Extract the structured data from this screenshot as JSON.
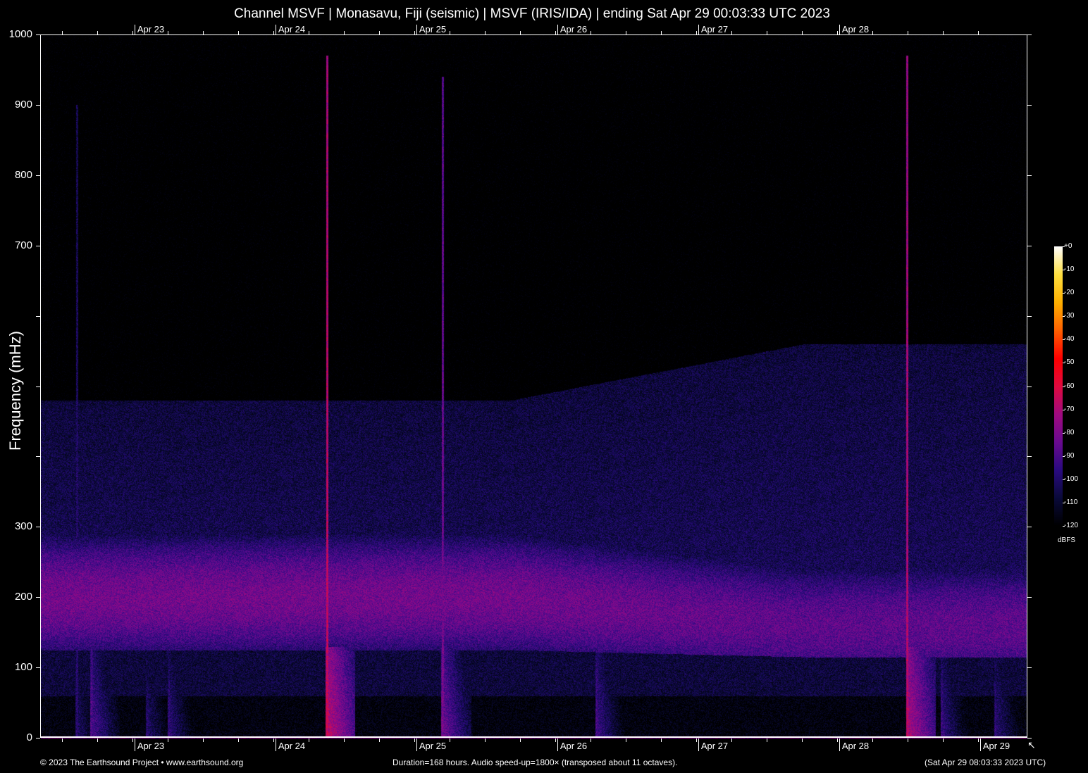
{
  "title": "Channel MSVF | Monasavu, Fiji (seismic) | MSVF (IRIS/IDA) | ending Sat Apr 29 00:03:33 UTC 2023",
  "footer": {
    "copyright": "© 2023 The Earthsound Project • www.earthsound.org",
    "info": "Duration=168 hours. Audio speed-up=1800× (transposed about 11 octaves).",
    "timestamp": "(Sat Apr 29 08:03:33 2023 UTC)"
  },
  "chart_data": {
    "type": "heatmap",
    "title": "Channel MSVF | Monasavu, Fiji (seismic) | MSVF (IRIS/IDA) | ending Sat Apr 29 00:03:33 UTC 2023",
    "xlabel": "",
    "ylabel": "Frequency (mHz)",
    "xlim_hours": [
      0,
      168
    ],
    "ylim": [
      0,
      1000
    ],
    "y_ticks": [
      0,
      100,
      200,
      300,
      400,
      500,
      600,
      700,
      800,
      900,
      1000
    ],
    "y_tick_labels": [
      "0",
      "100",
      "200",
      "300",
      "",
      "",
      "",
      "700",
      "800",
      "900",
      "1000"
    ],
    "x_ticks_hours": [
      16,
      40,
      64,
      88,
      112,
      136,
      160
    ],
    "x_tick_labels_top": [
      "Apr 23",
      "Apr 24",
      "Apr 25",
      "Apr 26",
      "Apr 27",
      "Apr 28",
      ""
    ],
    "x_tick_labels_bottom": [
      "Apr 23",
      "Apr 24",
      "Apr 25",
      "Apr 26",
      "Apr 27",
      "Apr 28",
      "Apr 29"
    ],
    "x_minor_tick_hours": 6,
    "colorbar": {
      "unit": "dBFS",
      "range": [
        -120,
        0
      ],
      "ticks": [
        "+0",
        "-10",
        "-20",
        "-30",
        "-40",
        "-50",
        "-60",
        "-70",
        "-80",
        "-90",
        "-100",
        "-110",
        "-120"
      ],
      "colormap": [
        "#000000",
        "#0a0a3a",
        "#2a0a80",
        "#6a0a90",
        "#a00a80",
        "#e00a40",
        "#ff0000",
        "#ff6000",
        "#ffb000",
        "#ffe040",
        "#ffffff"
      ]
    },
    "microseism_band_mHz": [
      120,
      280
    ],
    "events": [
      {
        "hour": 6.1,
        "level_dB": -95,
        "max_mHz": 900
      },
      {
        "hour": 8.6,
        "level_dB": -85,
        "max_mHz": 160
      },
      {
        "hour": 18.1,
        "level_dB": -95,
        "max_mHz": 80
      },
      {
        "hour": 21.8,
        "level_dB": -92,
        "max_mHz": 100
      },
      {
        "hour": 48.7,
        "level_dB": -62,
        "max_mHz": 970
      },
      {
        "hour": 68.4,
        "level_dB": -78,
        "max_mHz": 940
      },
      {
        "hour": 94.6,
        "level_dB": -88,
        "max_mHz": 110
      },
      {
        "hour": 147.5,
        "level_dB": -65,
        "max_mHz": 970
      },
      {
        "hour": 153.4,
        "level_dB": -90,
        "max_mHz": 100
      },
      {
        "hour": 162.5,
        "level_dB": -92,
        "max_mHz": 80
      }
    ]
  }
}
